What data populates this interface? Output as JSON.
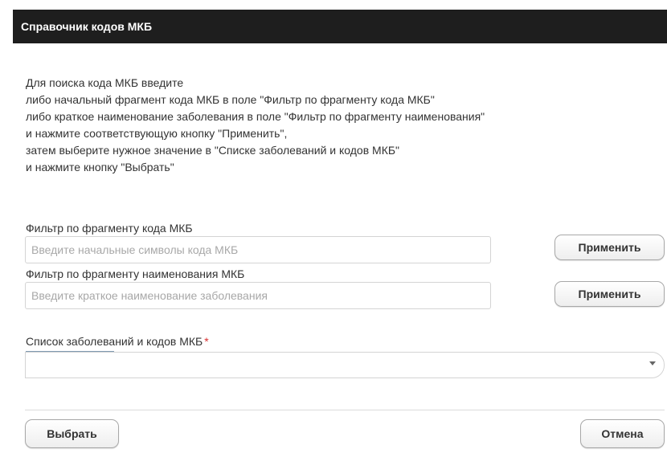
{
  "dialog": {
    "title": "Справочник кодов МКБ",
    "instructions": [
      "Для поиска кода МКБ введите",
      "либо начальный фрагмент кода МКБ в поле \"Фильтр по фрагменту кода МКБ\"",
      "либо краткое наименование заболевания в поле \"Фильтр по фрагменту наименования\"",
      "и нажмите соответствующую кнопку \"Применить\",",
      "затем выберите нужное значение в \"Списке заболеваний и кодов МКБ\"",
      "и нажмите кнопку \"Выбрать\""
    ]
  },
  "code_filter": {
    "label": "Фильтр по фрагменту кода МКБ",
    "value": "",
    "placeholder": "Введите начальные символы кода МКБ",
    "apply_label": "Применить"
  },
  "name_filter": {
    "label": "Фильтр по фрагменту наименования МКБ",
    "value": "",
    "placeholder": "Введите краткое наименование заболевания",
    "apply_label": "Применить"
  },
  "disease_list": {
    "label": "Список заболеваний и кодов МКБ",
    "required_mark": "*",
    "selected": "",
    "dropdown_icon": "chevron-down-icon"
  },
  "footer": {
    "select_label": "Выбрать",
    "cancel_label": "Отмена"
  },
  "colors": {
    "titlebar_bg": "#1e1e1e",
    "titlebar_text": "#ffffff",
    "required": "#d83030",
    "text": "#333333",
    "placeholder": "#a8a8a8"
  }
}
